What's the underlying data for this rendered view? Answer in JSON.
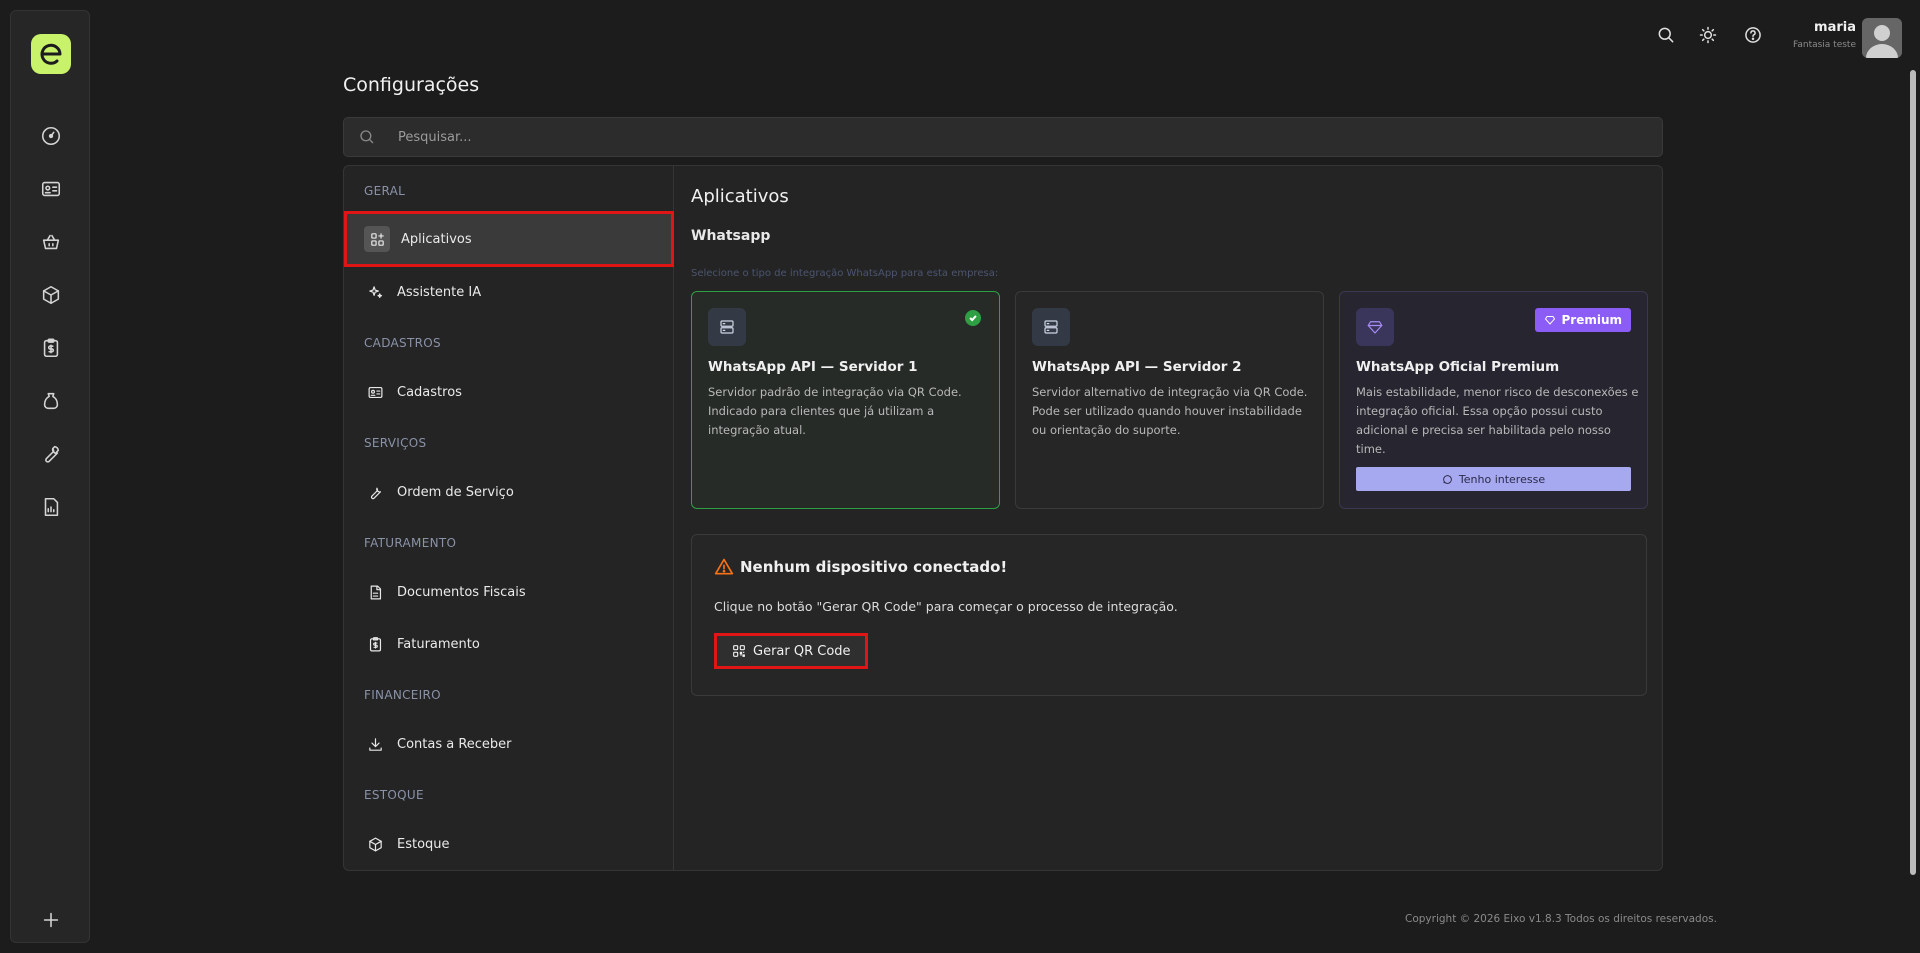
{
  "rail": {
    "items": [
      "dashboard-icon",
      "id-card-icon",
      "basket-icon",
      "box-icon",
      "clipboard-dollar-icon",
      "bag-icon",
      "wrench-icon",
      "report-icon"
    ],
    "add_icon": "plus-icon"
  },
  "topbar": {
    "user_name": "maria",
    "user_company": "Fantasia teste"
  },
  "page": {
    "title": "Configurações",
    "search_placeholder": "Pesquisar..."
  },
  "sidebar": {
    "sections": [
      {
        "label": "GERAL",
        "items": [
          {
            "label": "Aplicativos",
            "icon": "apps-icon",
            "active": true
          },
          {
            "label": "Assistente IA",
            "icon": "sparkle-icon"
          }
        ]
      },
      {
        "label": "CADASTROS",
        "items": [
          {
            "label": "Cadastros",
            "icon": "id-card-icon"
          }
        ]
      },
      {
        "label": "SERVIÇOS",
        "items": [
          {
            "label": "Ordem de Serviço",
            "icon": "wrench-icon"
          }
        ]
      },
      {
        "label": "FATURAMENTO",
        "items": [
          {
            "label": "Documentos Fiscais",
            "icon": "file-icon"
          },
          {
            "label": "Faturamento",
            "icon": "clipboard-dollar-icon"
          }
        ]
      },
      {
        "label": "FINANCEIRO",
        "items": [
          {
            "label": "Contas a Receber",
            "icon": "download-icon"
          }
        ]
      },
      {
        "label": "ESTOQUE",
        "items": [
          {
            "label": "Estoque",
            "icon": "box-icon"
          }
        ]
      }
    ]
  },
  "content": {
    "title": "Aplicativos",
    "subtitle": "Whatsapp",
    "hint": "Selecione o tipo de integração WhatsApp para esta empresa:",
    "cards": [
      {
        "title": "WhatsApp API — Servidor 1",
        "desc": "Servidor padrão de integração via QR Code. Indicado para clientes que já utilizam a integração atual.",
        "selected": true
      },
      {
        "title": "WhatsApp API — Servidor 2",
        "desc": "Servidor alternativo de integração via QR Code. Pode ser utilizado quando houver instabilidade ou orientação do suporte."
      },
      {
        "title": "WhatsApp Oficial Premium",
        "desc": "Mais estabilidade, menor risco de desconexões e integração oficial. Essa opção possui custo adicional e precisa ser habilitada pelo nosso time.",
        "badge": "Premium",
        "button": "Tenho interesse"
      }
    ],
    "status": {
      "title": "Nenhum dispositivo conectado!",
      "desc": "Clique no botão \"Gerar QR Code\" para começar o processo de integração.",
      "button": "Gerar QR Code"
    }
  },
  "footer": "Copyright © 2026 Eixo v1.8.3 Todos os direitos reservados.",
  "colors": {
    "accent": "#c9f26b",
    "selected": "#2ea043",
    "premium": "#8b5cf6",
    "annotation": "#e01515"
  }
}
